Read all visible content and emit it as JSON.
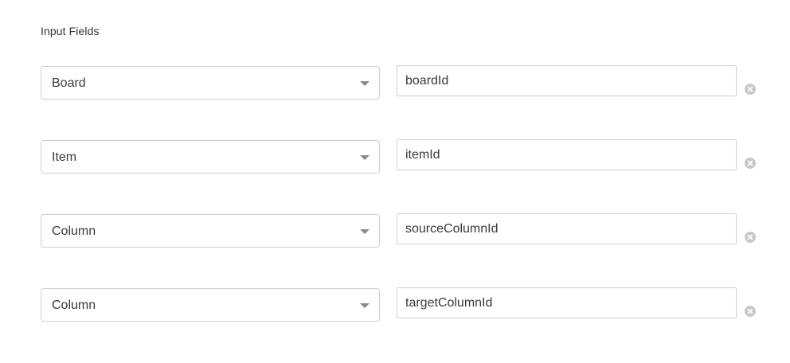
{
  "section": {
    "title": "Input Fields"
  },
  "fields": [
    {
      "select_value": "Board",
      "input_value": "boardId"
    },
    {
      "select_value": "Item",
      "input_value": "itemId"
    },
    {
      "select_value": "Column",
      "input_value": "sourceColumnId"
    },
    {
      "select_value": "Column",
      "input_value": "targetColumnId"
    }
  ],
  "icons": {
    "dropdown": "chevron-down-icon",
    "remove": "close-circle-icon"
  },
  "colors": {
    "border": "#cfcfcf",
    "caret": "#8a8a8a",
    "remove_icon": "#c8c8c8",
    "text": "#3a3a3a"
  }
}
